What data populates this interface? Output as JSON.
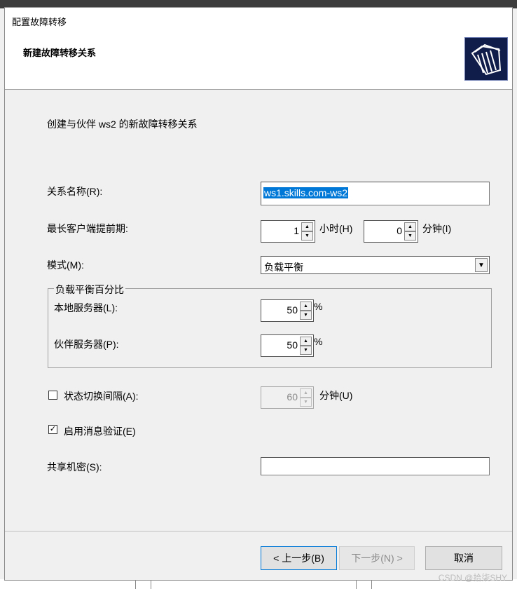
{
  "window": {
    "title": "配置故障转移"
  },
  "header": {
    "title": "新建故障转移关系",
    "icon": "folders-icon"
  },
  "description": "创建与伙伴 ws2 的新故障转移关系",
  "relationship_name": {
    "label": "关系名称(R):",
    "value": "ws1.skills.com-ws2"
  },
  "mclt": {
    "label": "最长客户端提前期:",
    "hours_value": "1",
    "hours_unit": "小时(H)",
    "minutes_value": "0",
    "minutes_unit": "分钟(I)"
  },
  "mode": {
    "label": "模式(M):",
    "selected": "负载平衡"
  },
  "load_balance": {
    "group_title": "负载平衡百分比",
    "local_label": "本地服务器(L):",
    "local_value": "50",
    "partner_label": "伙伴服务器(P):",
    "partner_value": "50",
    "percent": "%"
  },
  "state_switchover": {
    "label": "状态切换间隔(A):",
    "checked": false,
    "value": "60",
    "unit": "分钟(U)"
  },
  "message_auth": {
    "label": "启用消息验证(E)",
    "checked": true
  },
  "shared_secret": {
    "label": "共享机密(S):",
    "value": ""
  },
  "buttons": {
    "back": "< 上一步(B)",
    "next": "下一步(N) >",
    "cancel": "取消"
  },
  "watermark": "CSDN @拾柒SHY"
}
